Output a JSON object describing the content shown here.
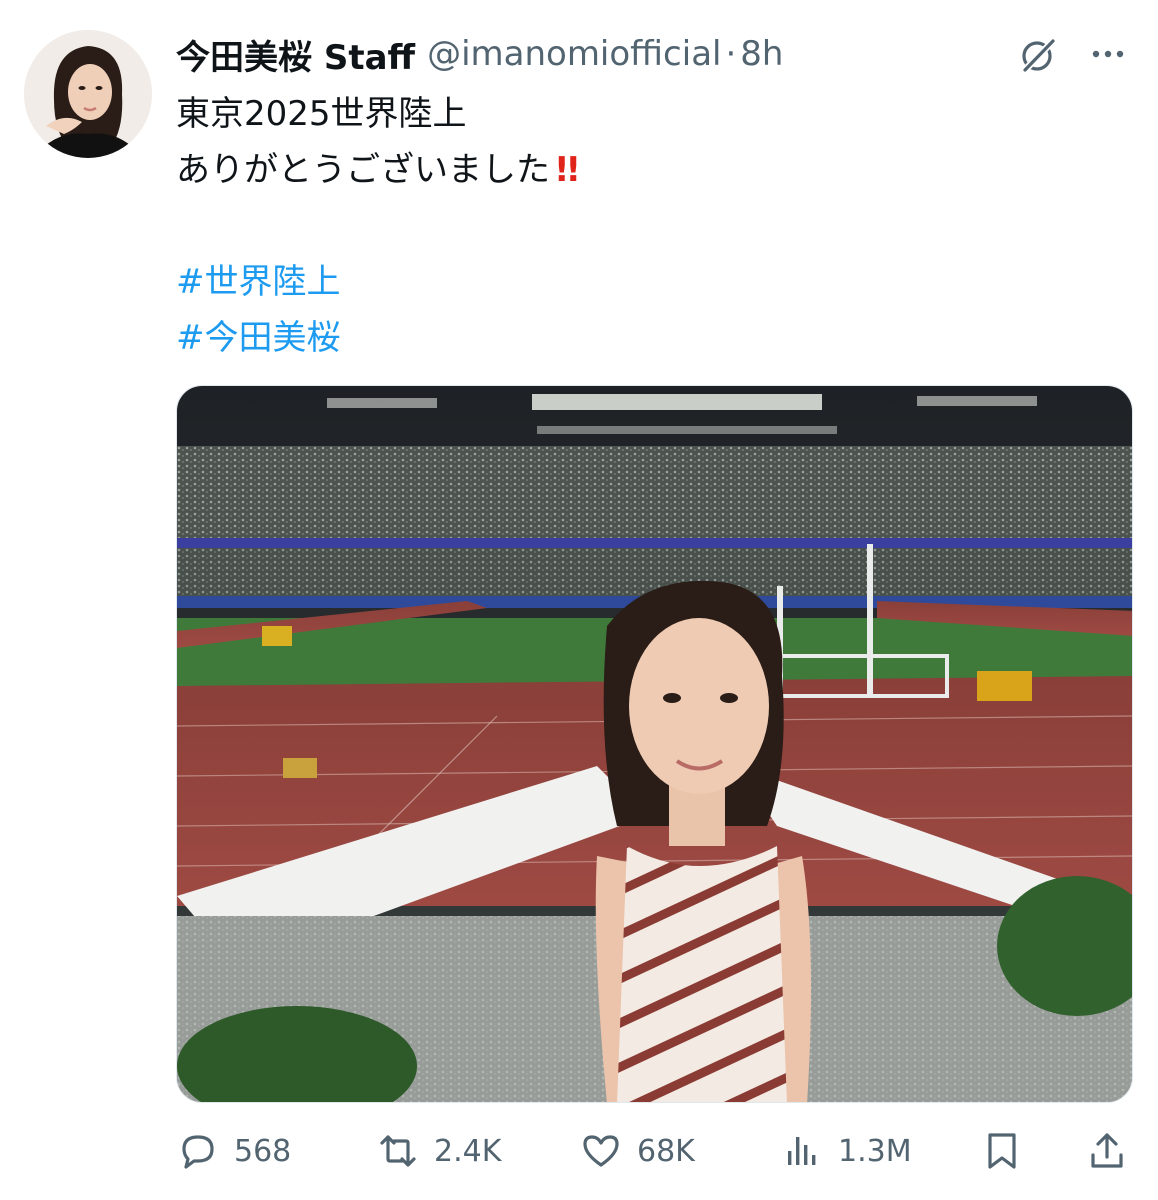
{
  "author": {
    "display_name": "今田美桜 Staff",
    "handle": "@imanomiofficial",
    "separator": "·",
    "time": "8h",
    "avatar_icon": "avatar-photo"
  },
  "tweet": {
    "line1": "東京2025世界陸上",
    "line2": "ありがとうございました",
    "line2_emoji": "!!",
    "hashtags": [
      "#世界陸上",
      "#今田美桜"
    ]
  },
  "media": {
    "description_icon": "stadium-photo"
  },
  "actions": {
    "replies": "568",
    "reposts": "2.4K",
    "likes": "68K",
    "views": "1.3M"
  },
  "colors": {
    "text": "#0f1419",
    "secondary": "#536471",
    "link": "#1d9bf0",
    "emoji_red": "#e0241c"
  },
  "icons": {
    "reply": "reply-icon",
    "repost": "repost-icon",
    "like": "like-icon",
    "views": "views-icon",
    "bookmark": "bookmark-icon",
    "share": "share-icon",
    "grok": "grok-icon",
    "more": "more-icon"
  }
}
